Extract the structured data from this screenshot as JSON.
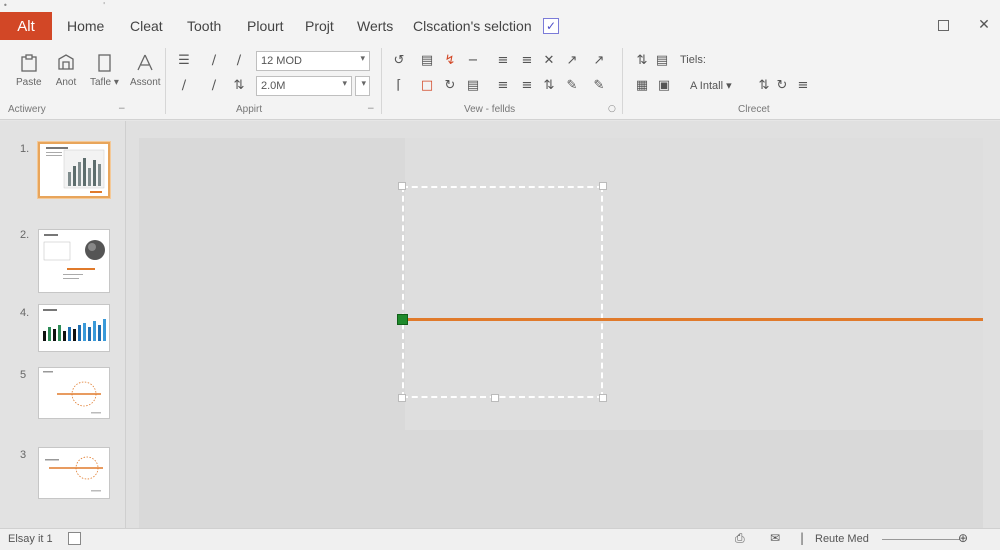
{
  "top_strip": {
    "left_glyph": "•",
    "mid_glyph": "'"
  },
  "tabs": {
    "file": "Alt",
    "items": [
      "Home",
      "Cleat",
      "Tooth",
      "Plourt",
      "Projt",
      "Werts",
      "Clscation's selction"
    ],
    "checkbox_mark": "✓"
  },
  "window": {
    "close_glyph": "✕"
  },
  "ribbon": {
    "clipboard": {
      "paste_label": "Paste",
      "anot_label": "Anot",
      "table_label": "Tafle",
      "table_arrow": "▾",
      "ascent_label": "Assont",
      "group_label": "Actiwery"
    },
    "font": {
      "font_name_value": "12 MOD",
      "font_size_value": "2.0M",
      "group_label": "Appirt"
    },
    "paragraph": {
      "group_label": "Vew - fellds"
    },
    "drawing": {
      "tiels_label": "Tiels:",
      "install_label": "A  Intall ▾",
      "group_label": "Clrecet"
    }
  },
  "slides": [
    "1.",
    "2.",
    "4.",
    "5",
    "3"
  ],
  "status": {
    "slide_counter": "Elsay it 1",
    "zoom_label": "Reute Med"
  },
  "colors": {
    "accent": "#d24726",
    "line": "#e07a2b",
    "handle": "#1f8a2c",
    "selection": "#e8a55b"
  }
}
